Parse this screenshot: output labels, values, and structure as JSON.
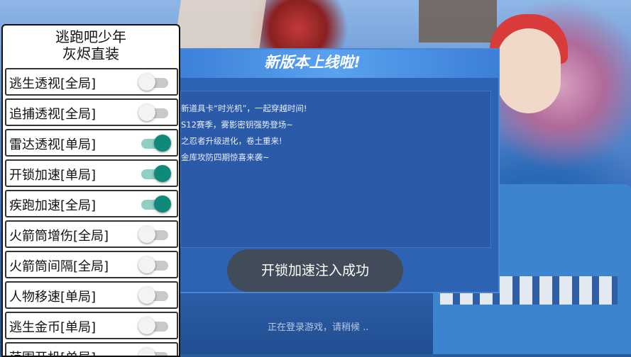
{
  "menu": {
    "title_line1": "逃跑吧少年",
    "title_line2": "灰烬直装",
    "items": [
      {
        "label": "逃生透视[全局]",
        "on": false
      },
      {
        "label": "追捕透视[全局]",
        "on": false
      },
      {
        "label": "雷达透视[单局]",
        "on": true
      },
      {
        "label": "开锁加速[单局]",
        "on": true
      },
      {
        "label": "疾跑加速[全局]",
        "on": true
      },
      {
        "label": "火箭筒增伤[全局]",
        "on": false
      },
      {
        "label": "火箭筒间隔[全局]",
        "on": false
      },
      {
        "label": "人物移速[单局]",
        "on": false
      },
      {
        "label": "逃生金币[单局]",
        "on": false
      },
      {
        "label": "范围开机[单局]",
        "on": false
      }
    ]
  },
  "news": {
    "title": "新版本上线啦!",
    "lines": [
      "新道具卡“时光机”，一起穿越时间!",
      "S12赛季，雾影密钥强势登场~",
      "之忍者升级进化，卷土重来!",
      "金库攻防四期惊喜来袭~"
    ],
    "status": "正在登录游戏，请稍候 .."
  },
  "toast": {
    "message": "开锁加速注入成功"
  },
  "colors": {
    "switch_on": "#0f8a7a",
    "switch_on_track": "#8fcfc4",
    "switch_off": "#f3f3f3",
    "dialog_blue": "#2e63b4"
  }
}
